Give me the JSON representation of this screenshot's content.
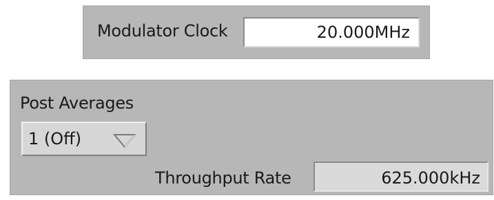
{
  "modulator_clock": {
    "label": "Modulator Clock",
    "value": "20.000MHz"
  },
  "post_averages": {
    "label": "Post Averages",
    "selected": "1 (Off)",
    "dropdown_icon": "chevron-down-icon"
  },
  "throughput_rate": {
    "label": "Throughput Rate",
    "value": "625.000kHz"
  },
  "colors": {
    "panel_background": "#b7b7b7",
    "field_background": "#ffffff",
    "readonly_field_background": "#dadada"
  }
}
